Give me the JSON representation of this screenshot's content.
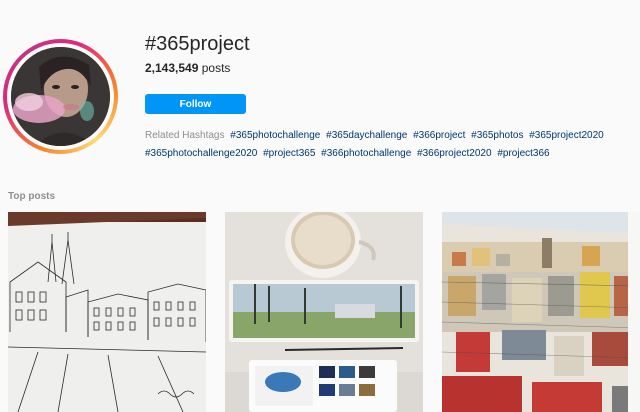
{
  "header": {
    "title": "#365project",
    "post_count": "2,143,549",
    "post_count_suffix": " posts",
    "follow_label": "Follow"
  },
  "related": {
    "label": "Related Hashtags",
    "tags": [
      "#365photochallenge",
      "#365daychallenge",
      "#366project",
      "#365photos",
      "#365project2020",
      "#365photochallenge2020",
      "#project365",
      "#366photochallenge",
      "#366project2020",
      "#project366"
    ]
  },
  "top_posts": {
    "label": "Top posts",
    "posts": [
      {
        "description": "pen sketch of town buildings with twin spires"
      },
      {
        "description": "coffee cup above watercolor landscape sketch and paint set"
      },
      {
        "description": "sketchbook watercolor painting of city rooftops"
      }
    ]
  },
  "colors": {
    "accent": "#0095f6",
    "link": "#00376b",
    "muted": "#8e8e8e"
  }
}
